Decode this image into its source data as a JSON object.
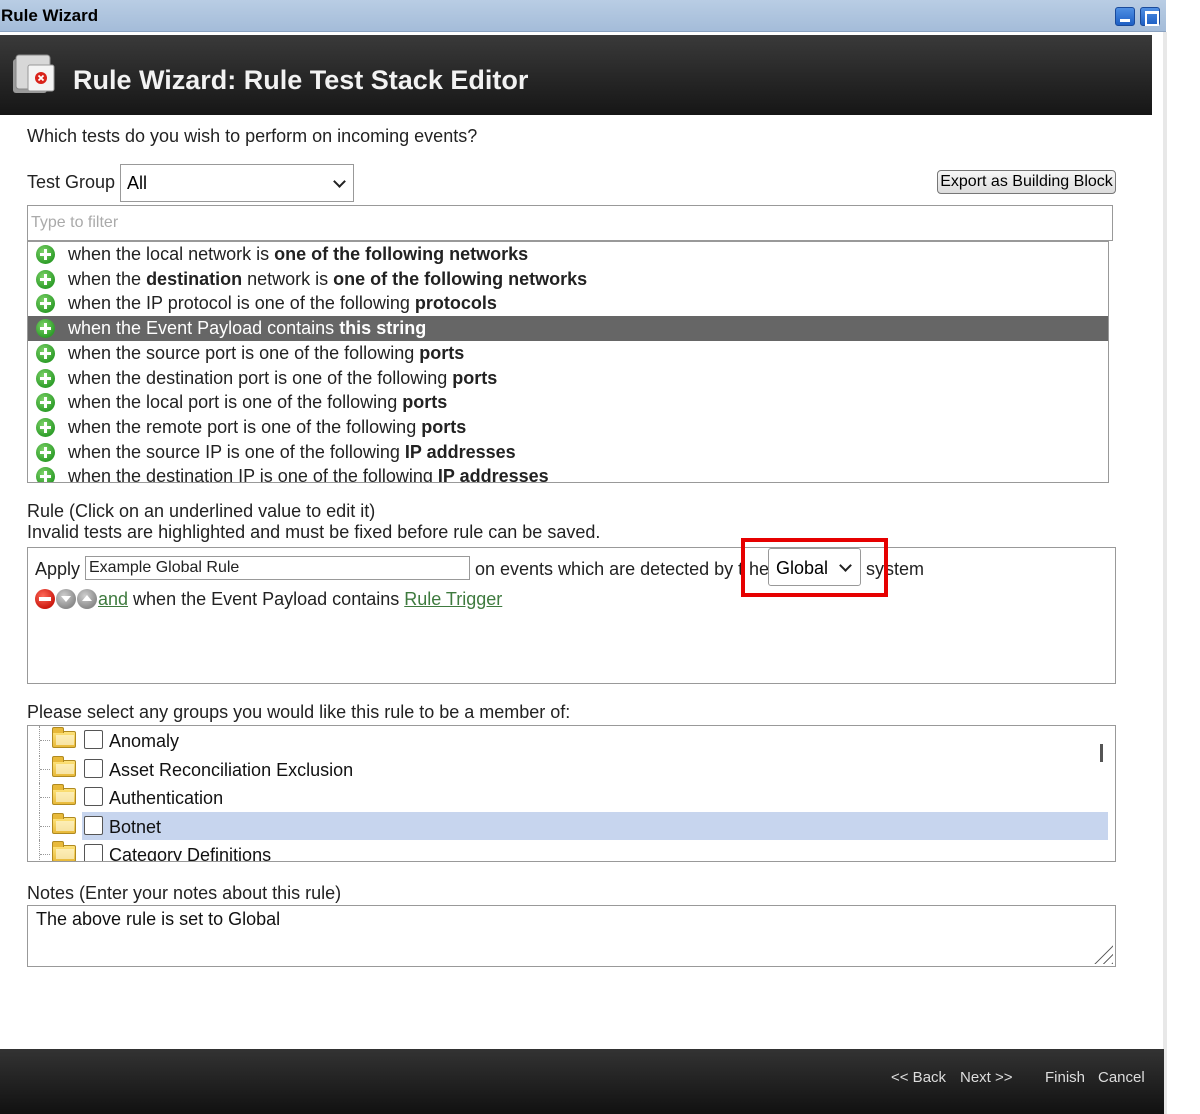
{
  "window": {
    "title": "Rule Wizard",
    "minimize_icon": "minimize-icon",
    "maximize_icon": "maximize-icon"
  },
  "header": {
    "title": "Rule Wizard: Rule Test Stack Editor",
    "icon": "rule-wizard-icon"
  },
  "question": "Which tests do you wish to perform on incoming events?",
  "test_group": {
    "label": "Test Group",
    "selected": "All"
  },
  "export_button": "Export as Building Block",
  "filter": {
    "placeholder": "Type to filter",
    "value": ""
  },
  "tests": [
    {
      "pre": "when the local network is ",
      "bold": "one of the following networks",
      "post": "",
      "icon": "add-icon"
    },
    {
      "pre": "when the ",
      "bold": "destination",
      "post": " network is ",
      "bold2": "one of the following networks",
      "icon": "add-icon"
    },
    {
      "pre": "when the IP protocol is one of the following ",
      "bold": "protocols",
      "post": "",
      "icon": "add-icon"
    },
    {
      "pre": "when the Event Payload contains ",
      "bold": "this string",
      "post": "",
      "icon": "add-icon",
      "selected": true
    },
    {
      "pre": "when the source port is one of the following ",
      "bold": "ports",
      "post": "",
      "icon": "add-icon"
    },
    {
      "pre": "when the destination port is one of the following ",
      "bold": "ports",
      "post": "",
      "icon": "add-icon"
    },
    {
      "pre": "when the local port is one of the following ",
      "bold": "ports",
      "post": "",
      "icon": "add-icon"
    },
    {
      "pre": "when the remote port is one of the following ",
      "bold": "ports",
      "post": "",
      "icon": "add-icon"
    },
    {
      "pre": "when the source IP is one of the following ",
      "bold": "IP addresses",
      "post": "",
      "icon": "add-icon"
    },
    {
      "pre": "when the destination IP is one of the following ",
      "bold": "IP addresses",
      "post": "",
      "icon": "add-icon"
    }
  ],
  "rule": {
    "heading": "Rule (Click on an underlined value to edit it)",
    "invalid_note": "Invalid tests are highlighted and must be fixed before rule can be saved.",
    "apply_label": "Apply",
    "rule_name": "Example Global Rule",
    "detected_text_a": "on events which are detected by t",
    "detected_text_b": "he",
    "system_select": "Global",
    "system_text_a": "sy",
    "system_text_b": "stem",
    "highlight_color": "#e60000",
    "condition": {
      "and_label": " and",
      "text": " when the Event Payload contains ",
      "value_link": "Rule Trigger",
      "icons": [
        "remove-icon",
        "move-down-icon",
        "move-up-icon"
      ]
    }
  },
  "groups": {
    "heading": "Please select any groups you would like this rule to be a member of:",
    "items": [
      {
        "label": "Anomaly",
        "checked": false
      },
      {
        "label": "Asset Reconciliation Exclusion",
        "checked": false
      },
      {
        "label": "Authentication",
        "checked": false
      },
      {
        "label": "Botnet",
        "checked": false,
        "selected": true
      },
      {
        "label": "Category Definitions",
        "checked": false
      }
    ]
  },
  "notes": {
    "heading": "Notes (Enter your notes about this rule)",
    "value": "The above rule is set to Global"
  },
  "footer": {
    "back": "<< Back",
    "next": "Next >>",
    "finish": "Finish",
    "cancel": "Cancel"
  }
}
